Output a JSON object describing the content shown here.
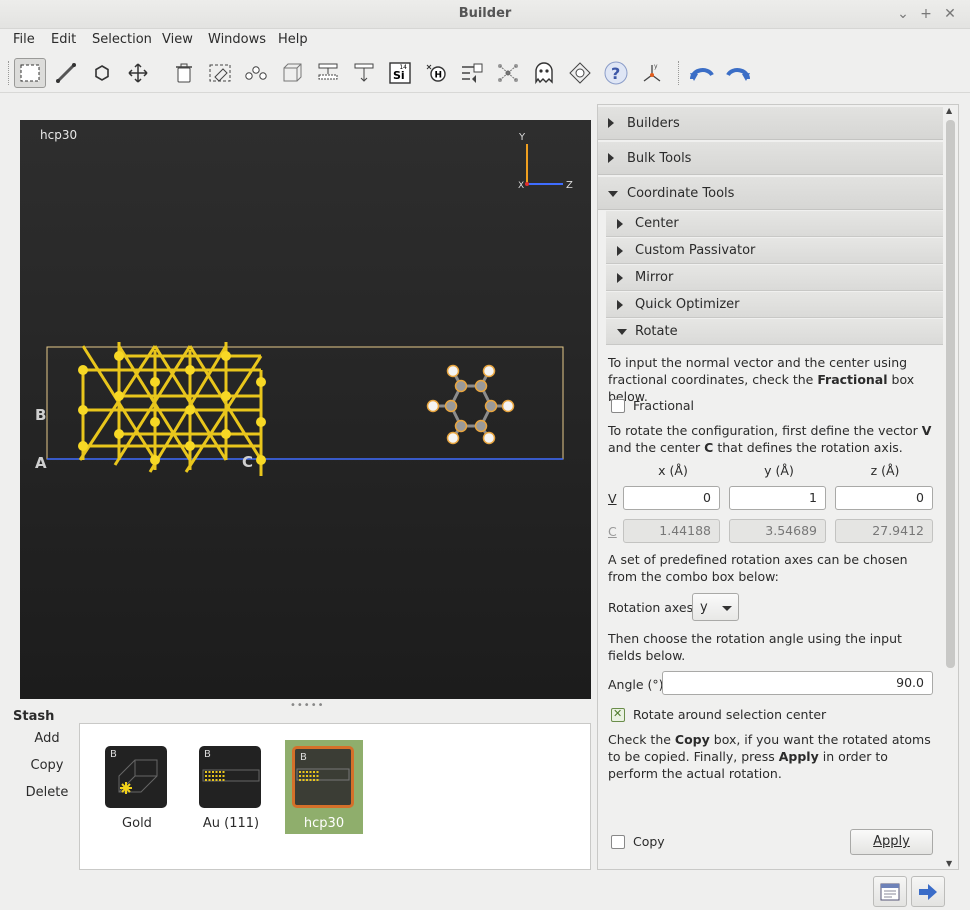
{
  "window": {
    "title": "Builder",
    "controls": [
      "⌄",
      "+",
      "✕"
    ]
  },
  "menu": [
    "File",
    "Edit",
    "Selection",
    "View",
    "Windows",
    "Help"
  ],
  "toolbar": {
    "icons": [
      "select-rectangle-icon",
      "measure-icon",
      "hexagon-icon",
      "move-icon",
      "delete-icon",
      "tag-icon",
      "chain-icon",
      "cube-icon",
      "slab-icon",
      "layers-icon",
      "element-si-icon",
      "hydrogen-icon",
      "transform-icon",
      "molecule-icon",
      "ghost-icon",
      "wrap-icon",
      "help-icon",
      "axes-icon",
      "undo-icon",
      "redo-icon"
    ],
    "element_label": "Si",
    "element_number": "14"
  },
  "viewport": {
    "label": "hcp30",
    "axis_y": "Y",
    "axis_z": "Z",
    "axis_x": "X",
    "cell_a": "A",
    "cell_b": "B",
    "cell_c": "C",
    "atom_color": "#f2d21a",
    "cell_line_color": "#3f6dff"
  },
  "stash": {
    "title": "Stash",
    "buttons": [
      "Add",
      "Copy",
      "Delete"
    ],
    "items": [
      {
        "badge": "B",
        "label": "Gold"
      },
      {
        "badge": "B",
        "label": "Au (111)"
      },
      {
        "badge": "B",
        "label": "hcp30"
      }
    ]
  },
  "panel": {
    "builders": "Builders",
    "bulk_tools": "Bulk Tools",
    "coordinate_tools": "Coordinate Tools",
    "center": "Center",
    "custom_passivator": "Custom Passivator",
    "mirror": "Mirror",
    "quick_optimizer": "Quick Optimizer",
    "rotate": "Rotate",
    "intro_a": "To input the normal vector and the center using fractional coordinates, check the ",
    "intro_bold": "Fractional",
    "intro_b": " box below.",
    "fractional_label": "Fractional",
    "config_a": "To rotate the configuration, first define the vector ",
    "config_v": "V",
    "config_b": " and the center ",
    "config_c": "C",
    "config_d": " that defines the rotation axis.",
    "col_x": "x (Å)",
    "col_y": "y (Å)",
    "col_z": "z (Å)",
    "row_v": "V",
    "row_c": "C",
    "v_x": "0",
    "v_y": "1",
    "v_z": "0",
    "c_x": "1.44188",
    "c_y": "3.54689",
    "c_z": "27.9412",
    "predefined": "A set of predefined rotation axes can be chosen from the combo box below:",
    "rotation_axes_label": "Rotation axes",
    "rotation_axes_value": "y",
    "choose_angle": "Then choose the rotation angle using the input fields below.",
    "angle_label": "Angle (°)",
    "angle_value": "90.0",
    "rotate_center_label": "Rotate around selection center",
    "copy_a": "Check the ",
    "copy_bold": "Copy",
    "copy_b": " box, if you want the rotated atoms to be copied. Finally, press ",
    "apply_bold": "Apply",
    "copy_c": " in order to perform the actual rotation.",
    "copy_label": "Copy",
    "apply_label": "Apply"
  }
}
